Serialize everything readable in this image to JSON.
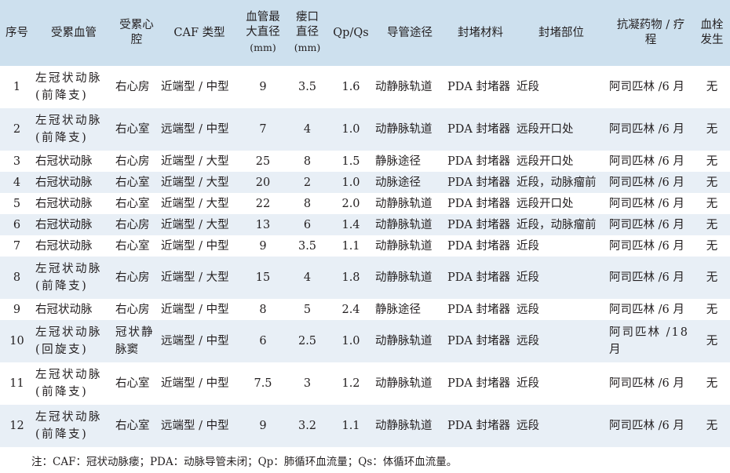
{
  "headers": [
    [
      "序号"
    ],
    [
      "受累血管"
    ],
    [
      "受累心",
      "腔"
    ],
    [
      "CAF 类型"
    ],
    [
      "血管最",
      "大直径",
      "(mm)"
    ],
    [
      "瘘口",
      "直径",
      "(mm)"
    ],
    [
      "Qp/Qs"
    ],
    [
      "导管途径"
    ],
    [
      "封堵材料"
    ],
    [
      "封堵部位"
    ],
    [
      "抗凝药物 / 疗",
      "程"
    ],
    [
      "血栓",
      "发生"
    ]
  ],
  "rows": [
    {
      "no": "1",
      "vessel": [
        "左冠状动脉",
        "(前降支)"
      ],
      "chamber": [
        "右心房"
      ],
      "type": "近端型 / 中型",
      "vmax": "9",
      "fistula": "3.5",
      "qpqs": "1.6",
      "route": "动静脉轨道",
      "material": "PDA 封堵器",
      "site": "近段",
      "anticoag": [
        "阿司匹林 /6 月"
      ],
      "thrombus": "无"
    },
    {
      "no": "2",
      "vessel": [
        "左冠状动脉",
        "(前降支)"
      ],
      "chamber": [
        "右心室"
      ],
      "type": "远端型 / 中型",
      "vmax": "7",
      "fistula": "4",
      "qpqs": "1.0",
      "route": "动静脉轨道",
      "material": "PDA 封堵器",
      "site": "远段开口处",
      "anticoag": [
        "阿司匹林 /6 月"
      ],
      "thrombus": "无"
    },
    {
      "no": "3",
      "vessel": [
        "右冠状动脉"
      ],
      "chamber": [
        "右心房"
      ],
      "type": "近端型 / 大型",
      "vmax": "25",
      "fistula": "8",
      "qpqs": "1.5",
      "route": "静脉途径",
      "material": "PDA 封堵器",
      "site": "远段开口处",
      "anticoag": [
        "阿司匹林 /6 月"
      ],
      "thrombus": "无"
    },
    {
      "no": "4",
      "vessel": [
        "右冠状动脉"
      ],
      "chamber": [
        "右心室"
      ],
      "type": "近端型 / 大型",
      "vmax": "20",
      "fistula": "2",
      "qpqs": "1.0",
      "route": "动脉途径",
      "material": "PDA 封堵器",
      "site": "近段，动脉瘤前",
      "anticoag": [
        "阿司匹林 /6 月"
      ],
      "thrombus": "无"
    },
    {
      "no": "5",
      "vessel": [
        "右冠状动脉"
      ],
      "chamber": [
        "右心室"
      ],
      "type": "近端型 / 大型",
      "vmax": "22",
      "fistula": "8",
      "qpqs": "2.0",
      "route": "动静脉轨道",
      "material": "PDA 封堵器",
      "site": "远段开口处",
      "anticoag": [
        "阿司匹林 /6 月"
      ],
      "thrombus": "无"
    },
    {
      "no": "6",
      "vessel": [
        "右冠状动脉"
      ],
      "chamber": [
        "右心房"
      ],
      "type": "近端型 / 大型",
      "vmax": "13",
      "fistula": "6",
      "qpqs": "1.4",
      "route": "动静脉轨道",
      "material": "PDA 封堵器",
      "site": "近段，动脉瘤前",
      "anticoag": [
        "阿司匹林 /6 月"
      ],
      "thrombus": "无"
    },
    {
      "no": "7",
      "vessel": [
        "右冠状动脉"
      ],
      "chamber": [
        "右心室"
      ],
      "type": "近端型 / 中型",
      "vmax": "9",
      "fistula": "3.5",
      "qpqs": "1.1",
      "route": "动静脉轨道",
      "material": "PDA 封堵器",
      "site": "近段",
      "anticoag": [
        "阿司匹林 /6 月"
      ],
      "thrombus": "无"
    },
    {
      "no": "8",
      "vessel": [
        "左冠状动脉",
        "(前降支)"
      ],
      "chamber": [
        "右心房"
      ],
      "type": "近端型 / 大型",
      "vmax": "15",
      "fistula": "4",
      "qpqs": "1.8",
      "route": "动静脉轨道",
      "material": "PDA 封堵器",
      "site": "近段",
      "anticoag": [
        "阿司匹林 /6 月"
      ],
      "thrombus": "无"
    },
    {
      "no": "9",
      "vessel": [
        "右冠状动脉"
      ],
      "chamber": [
        "右心房"
      ],
      "type": "近端型 / 中型",
      "vmax": "8",
      "fistula": "5",
      "qpqs": "2.4",
      "route": "静脉途径",
      "material": "PDA 封堵器",
      "site": "远段",
      "anticoag": [
        "阿司匹林 /6 月"
      ],
      "thrombus": "无"
    },
    {
      "no": "10",
      "vessel": [
        "左冠状动脉",
        "(回旋支)"
      ],
      "chamber": [
        "冠状静",
        "脉窦"
      ],
      "type": "远端型 / 中型",
      "vmax": "6",
      "fistula": "2.5",
      "qpqs": "1.0",
      "route": "动静脉轨道",
      "material": "PDA 封堵器",
      "site": "远段",
      "anticoag": [
        "阿司匹林 /18",
        "月"
      ],
      "thrombus": "无"
    },
    {
      "no": "11",
      "vessel": [
        "左冠状动脉",
        "(前降支)"
      ],
      "chamber": [
        "右心室"
      ],
      "type": "近端型 / 中型",
      "vmax": "7.5",
      "fistula": "3",
      "qpqs": "1.2",
      "route": "动静脉轨道",
      "material": "PDA 封堵器",
      "site": "近段",
      "anticoag": [
        "阿司匹林 /6 月"
      ],
      "thrombus": "无"
    },
    {
      "no": "12",
      "vessel": [
        "左冠状动脉",
        "(前降支)"
      ],
      "chamber": [
        "右心室"
      ],
      "type": "远端型 / 中型",
      "vmax": "9",
      "fistula": "3.2",
      "qpqs": "1.1",
      "route": "动静脉轨道",
      "material": "PDA 封堵器",
      "site": "远段",
      "anticoag": [
        "阿司匹林 /6 月"
      ],
      "thrombus": "无"
    }
  ],
  "note": "注：CAF：冠状动脉瘘；PDA：动脉导管未闭；Qp：肺循环血流量；Qs：体循环血流量。",
  "colors": {
    "header_bg": "#cde0ee",
    "stripe_bg": "#e8eff6",
    "text": "#231f20"
  }
}
